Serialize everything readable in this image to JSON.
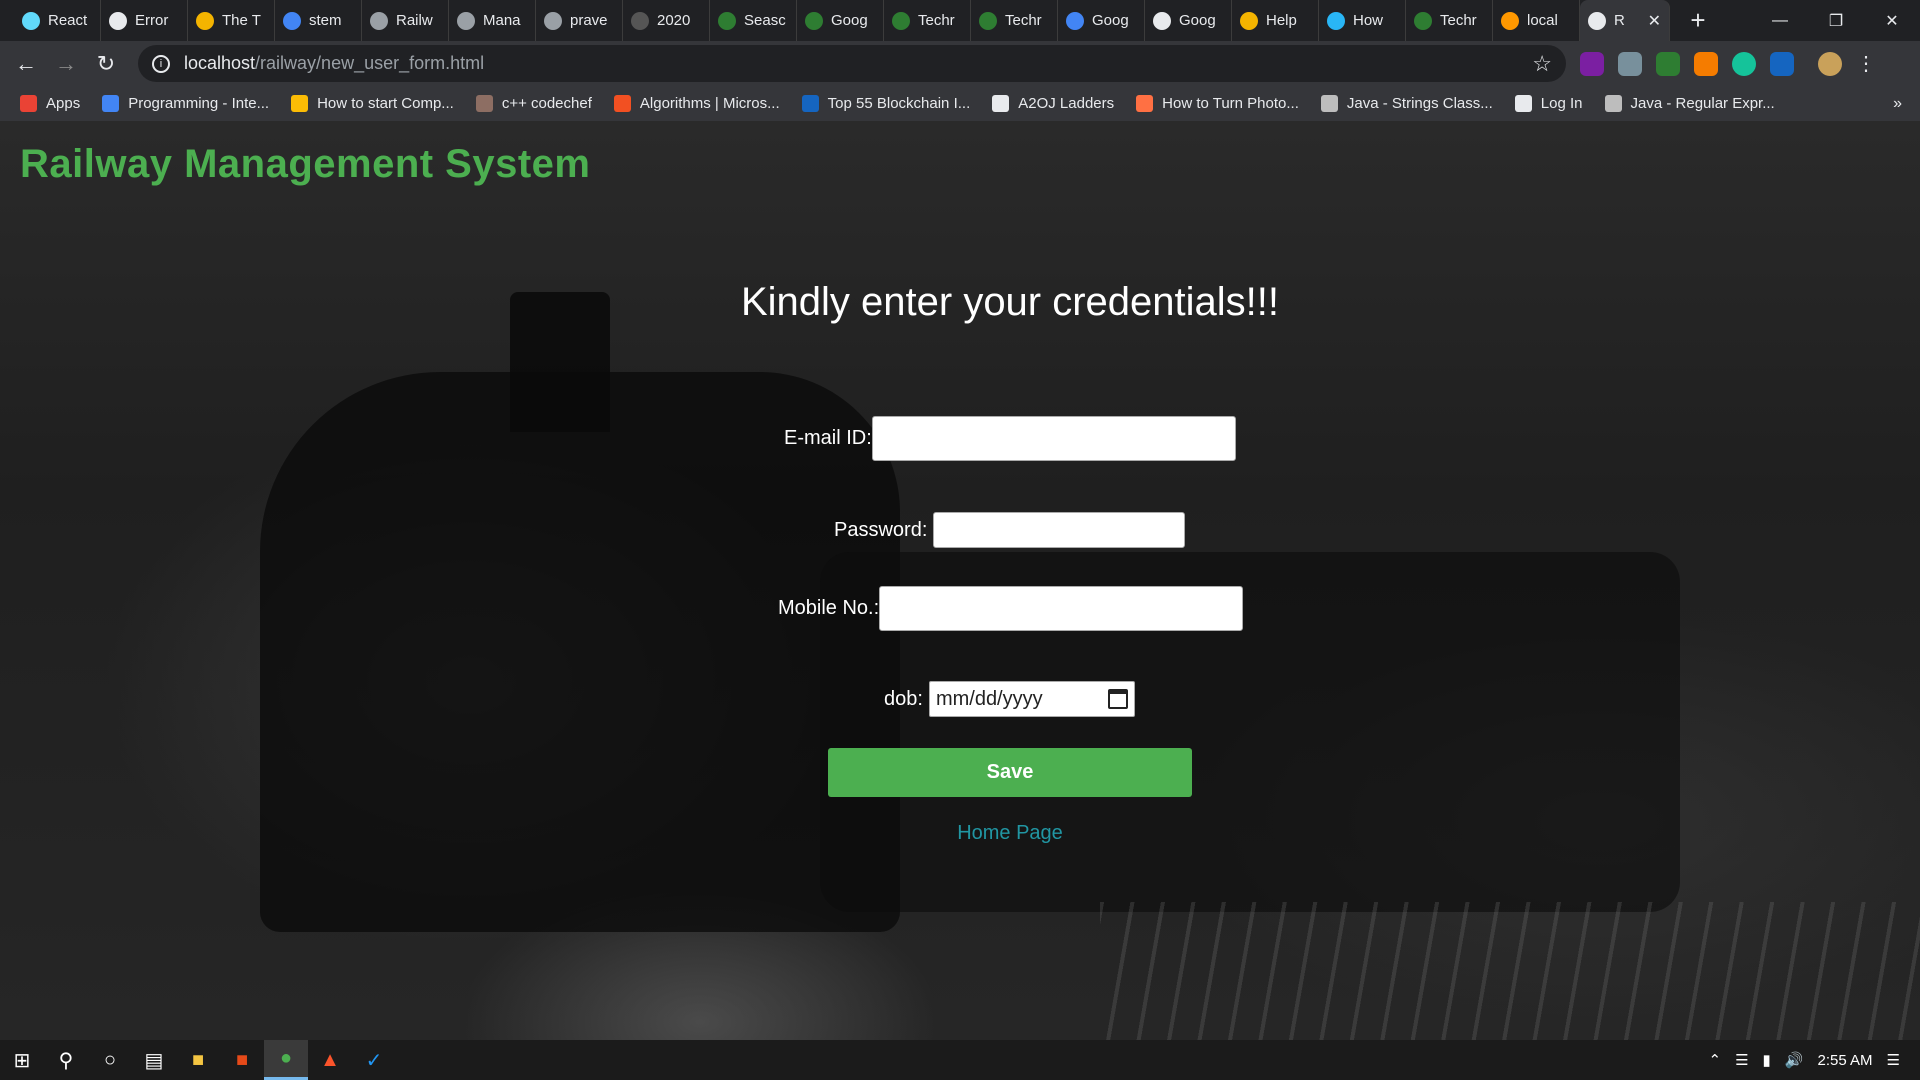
{
  "browser": {
    "tabs": [
      {
        "label": "React",
        "color": "#61dafb"
      },
      {
        "label": "Error",
        "color": "#e8eaed"
      },
      {
        "label": "The T",
        "color": "#f4b400"
      },
      {
        "label": "stem",
        "color": "#4285f4"
      },
      {
        "label": "Railw",
        "color": "#9aa0a6"
      },
      {
        "label": "Mana",
        "color": "#9aa0a6"
      },
      {
        "label": "prave",
        "color": "#9aa0a6"
      },
      {
        "label": "2020",
        "color": "#555555"
      },
      {
        "label": "Seasc",
        "color": "#2e7d32"
      },
      {
        "label": "Goog",
        "color": "#2e7d32"
      },
      {
        "label": "Techr",
        "color": "#2e7d32"
      },
      {
        "label": "Techr",
        "color": "#2e7d32"
      },
      {
        "label": "Goog",
        "color": "#4285f4"
      },
      {
        "label": "Goog",
        "color": "#e8eaed"
      },
      {
        "label": "Help",
        "color": "#f4b400"
      },
      {
        "label": "How",
        "color": "#29b6f6"
      },
      {
        "label": "Techr",
        "color": "#2e7d32"
      },
      {
        "label": "local",
        "color": "#ff9800"
      }
    ],
    "active_tab": {
      "label": "R",
      "close": "✕"
    },
    "new_tab": "+",
    "window_controls": {
      "minimize": "—",
      "maximize": "❐",
      "close": "✕"
    },
    "url_host": "localhost",
    "url_path": "/railway/new_user_form.html",
    "bookmarks": [
      {
        "label": "Apps",
        "color": "#ea4335"
      },
      {
        "label": "Programming - Inte...",
        "color": "#4285f4"
      },
      {
        "label": "How to start Comp...",
        "color": "#fbbc05"
      },
      {
        "label": "c++ codechef",
        "color": "#8d6e63"
      },
      {
        "label": "Algorithms | Micros...",
        "color": "#f25022"
      },
      {
        "label": "Top 55 Blockchain I...",
        "color": "#1565c0"
      },
      {
        "label": "A2OJ Ladders",
        "color": "#e8eaed"
      },
      {
        "label": "How to Turn Photo...",
        "color": "#ff7043"
      },
      {
        "label": "Java - Strings Class...",
        "color": "#bdbdbd"
      },
      {
        "label": "Log In",
        "color": "#e8eaed"
      },
      {
        "label": "Java - Regular Expr...",
        "color": "#bdbdbd"
      }
    ],
    "bookmarks_more": "»"
  },
  "page": {
    "site_title": "Railway Management System",
    "heading": "Kindly enter your credentials!!!",
    "form": {
      "email_label": "E-mail ID:",
      "password_label": "Password:",
      "mobile_label": "Mobile No.:",
      "dob_label": "dob:",
      "dob_placeholder": "mm/dd/yyyy",
      "save_label": "Save"
    },
    "home_link": "Home Page",
    "accent_color": "#4caf50",
    "link_color": "#2196a3"
  },
  "taskbar": {
    "time": "2:55 AM"
  }
}
